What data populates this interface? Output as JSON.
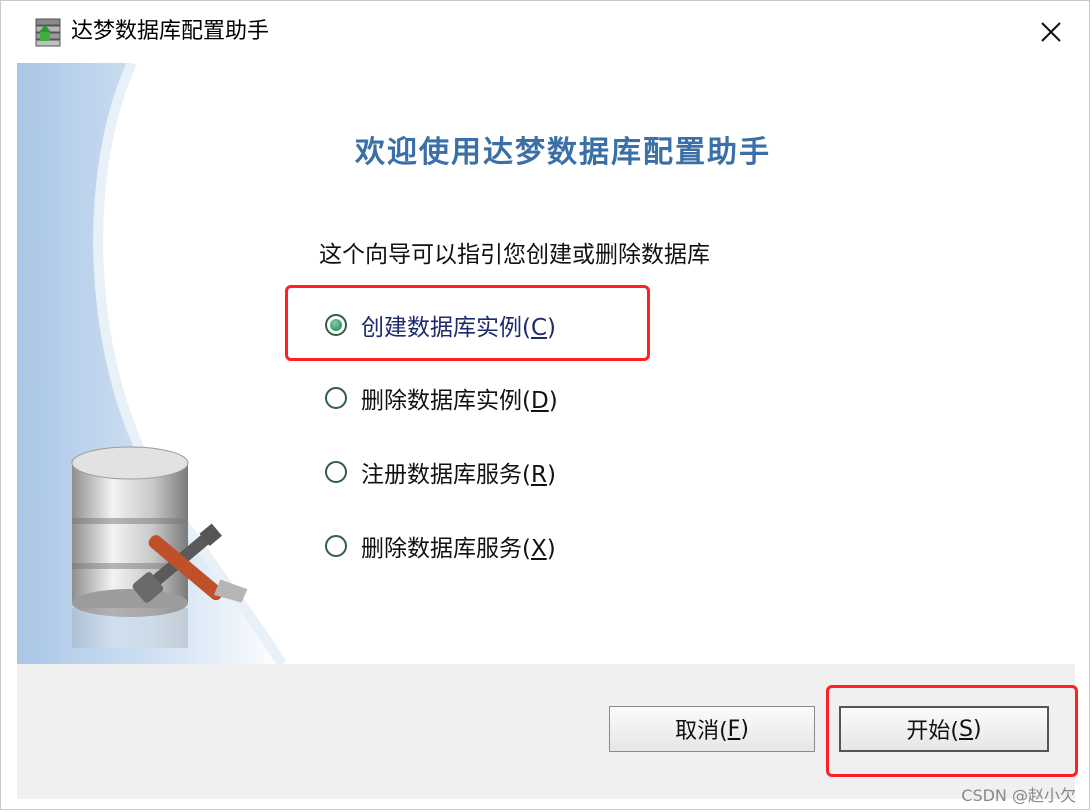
{
  "window": {
    "title": "达梦数据库配置助手"
  },
  "welcome": {
    "heading": "欢迎使用达梦数据库配置助手",
    "intro": "这个向导可以指引您创建或删除数据库"
  },
  "options": [
    {
      "label": "创建数据库实例(",
      "hotkey": "C",
      "suffix": ")",
      "selected": true
    },
    {
      "label": "删除数据库实例(",
      "hotkey": "D",
      "suffix": ")",
      "selected": false
    },
    {
      "label": "注册数据库服务(",
      "hotkey": "R",
      "suffix": ")",
      "selected": false
    },
    {
      "label": "删除数据库服务(",
      "hotkey": "X",
      "suffix": ")",
      "selected": false
    }
  ],
  "buttons": {
    "cancel": {
      "label": "取消(",
      "hotkey": "F",
      "suffix": ")"
    },
    "start": {
      "label": "开始(",
      "hotkey": "S",
      "suffix": ")"
    }
  },
  "watermark": "CSDN @赵小欠",
  "colors": {
    "heading": "#3a6fa8",
    "highlight": "#ff2020",
    "radio": "#2f5e44"
  },
  "icons": {
    "app": "database-app-icon",
    "illustration": "database-tools-icon",
    "close": "close-icon"
  }
}
